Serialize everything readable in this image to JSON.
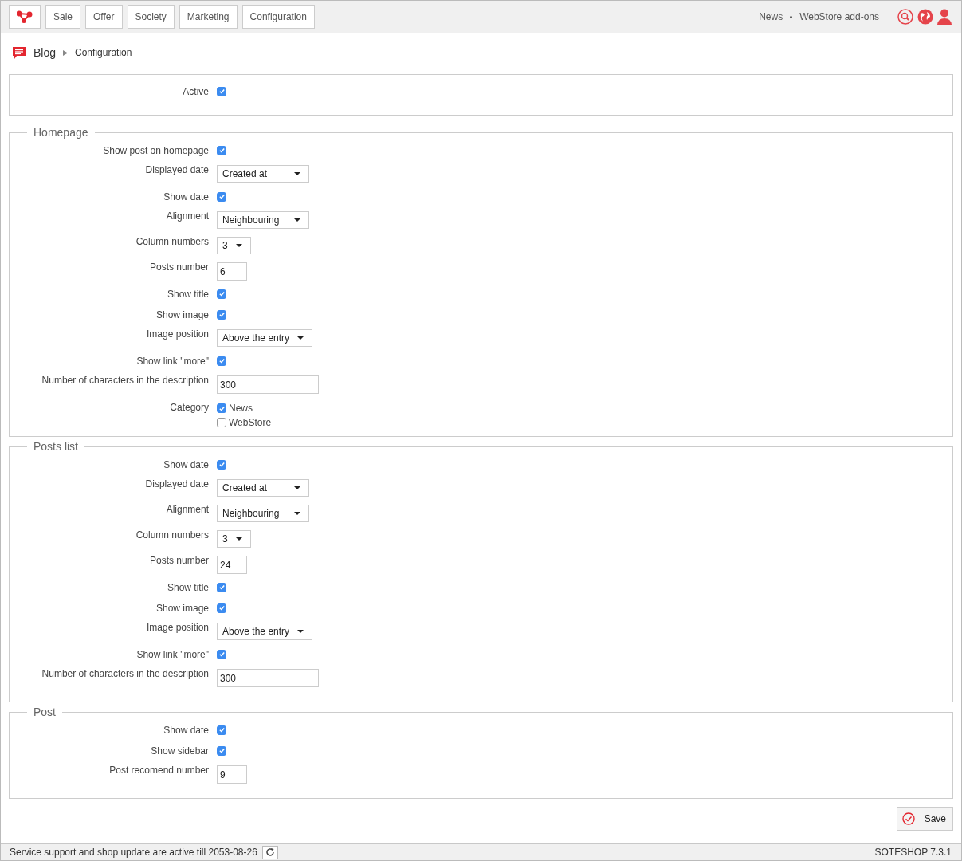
{
  "nav": {
    "tabs": [
      {
        "label": "Sale"
      },
      {
        "label": "Offer"
      },
      {
        "label": "Society"
      },
      {
        "label": "Marketing"
      },
      {
        "label": "Configuration"
      }
    ],
    "links": [
      "News",
      "WebStore add-ons"
    ]
  },
  "breadcrumb": {
    "section": "Blog",
    "page": "Configuration"
  },
  "sections": [
    {
      "fields": [
        {
          "kind": "checkbox",
          "label": "Active",
          "checked": true
        }
      ]
    },
    {
      "legend": "Homepage",
      "fields": [
        {
          "kind": "checkbox",
          "label": "Show post on homepage",
          "checked": true
        },
        {
          "kind": "select",
          "label": "Displayed date",
          "value": "Created at"
        },
        {
          "kind": "checkbox",
          "label": "Show date",
          "checked": true
        },
        {
          "kind": "select",
          "label": "Alignment",
          "value": "Neighbouring"
        },
        {
          "kind": "select",
          "label": "Column numbers",
          "value": "3"
        },
        {
          "kind": "text",
          "label": "Posts number",
          "value": "6"
        },
        {
          "kind": "checkbox",
          "label": "Show title",
          "checked": true
        },
        {
          "kind": "checkbox",
          "label": "Show image",
          "checked": true
        },
        {
          "kind": "select",
          "label": "Image position",
          "value": "Above the entry"
        },
        {
          "kind": "checkbox",
          "label": "Show link \"more\"",
          "checked": true
        },
        {
          "kind": "text",
          "label": "Number of characters in the description",
          "value": "300"
        },
        {
          "kind": "checklist",
          "label": "Category",
          "options": [
            {
              "label": "News",
              "checked": true
            },
            {
              "label": "WebStore",
              "checked": false
            }
          ]
        }
      ]
    },
    {
      "legend": "Posts list",
      "fields": [
        {
          "kind": "checkbox",
          "label": "Show date",
          "checked": true
        },
        {
          "kind": "select",
          "label": "Displayed date",
          "value": "Created at"
        },
        {
          "kind": "select",
          "label": "Alignment",
          "value": "Neighbouring"
        },
        {
          "kind": "select",
          "label": "Column numbers",
          "value": "3"
        },
        {
          "kind": "text",
          "label": "Posts number",
          "value": "24"
        },
        {
          "kind": "checkbox",
          "label": "Show title",
          "checked": true
        },
        {
          "kind": "checkbox",
          "label": "Show image",
          "checked": true
        },
        {
          "kind": "select",
          "label": "Image position",
          "value": "Above the entry"
        },
        {
          "kind": "checkbox",
          "label": "Show link \"more\"",
          "checked": true
        },
        {
          "kind": "text",
          "label": "Number of characters in the description",
          "value": "300"
        }
      ]
    },
    {
      "legend": "Post",
      "fields": [
        {
          "kind": "checkbox",
          "label": "Show date",
          "checked": true
        },
        {
          "kind": "checkbox",
          "label": "Show sidebar",
          "checked": true
        },
        {
          "kind": "text",
          "label": "Post recomend number",
          "value": "9"
        }
      ]
    }
  ],
  "save_button": "Save",
  "status_bar": {
    "message": "Service support and shop update are active till 2053-08-26",
    "version": "SOTESHOP 7.3.1"
  }
}
